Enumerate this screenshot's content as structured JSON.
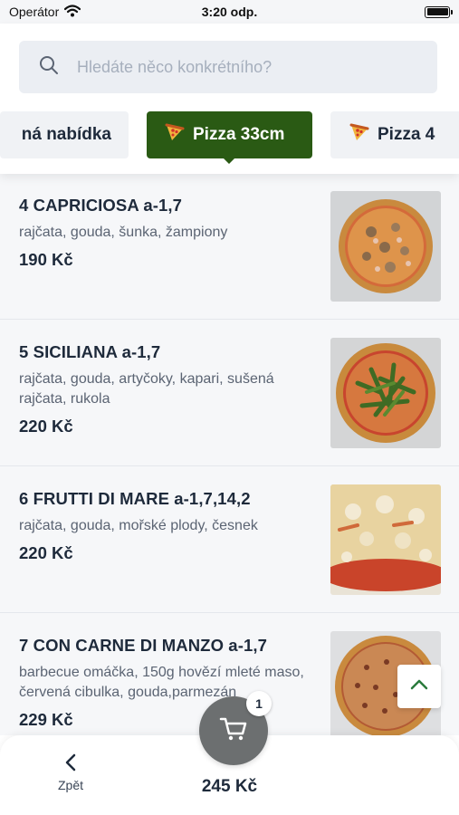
{
  "status_bar": {
    "carrier": "Operátor",
    "time": "3:20 odp."
  },
  "search": {
    "placeholder": "Hledáte něco konkrétního?"
  },
  "tabs": [
    {
      "label": "ná nabídka",
      "icon": "none",
      "active": false
    },
    {
      "label": "Pizza 33cm",
      "icon": "pizza-slice",
      "active": true
    },
    {
      "label": "Pizza 4",
      "icon": "pizza-slice",
      "active": false
    }
  ],
  "menu_items": [
    {
      "name": "4 CAPRICIOSA a-1,7",
      "desc": "rajčata, gouda, šunka, žampiony",
      "price": "190 Kč",
      "image": "pizza-capriciosa"
    },
    {
      "name": "5 SICILIANA a-1,7",
      "desc": "rajčata, gouda, artyčoky, kapari, sušená rajčata, rukola",
      "price": "220 Kč",
      "image": "pizza-siciliana"
    },
    {
      "name": "6 FRUTTI DI MARE a-1,7,14,2",
      "desc": "rajčata, gouda, mořské plody, česnek",
      "price": "220 Kč",
      "image": "pizza-frutti-di-mare"
    },
    {
      "name": "7 CON CARNE DI MANZO a-1,7",
      "desc": "barbecue omáčka, 150g hovězí mleté maso, červená cibulka, gouda,parmezán",
      "price": "229 Kč",
      "image": "pizza-con-carne"
    }
  ],
  "bottom_bar": {
    "back_label": "Zpět",
    "total": "245 Kč",
    "cart_count": "1"
  },
  "colors": {
    "accent": "#2a5a14",
    "tab_inactive": "#f0f2f5",
    "list_bg": "#f6f7f9",
    "cart_bg": "#6c6f70",
    "search_bg": "#ebeef3",
    "scroll_top_arrow": "#2a7a3c"
  }
}
